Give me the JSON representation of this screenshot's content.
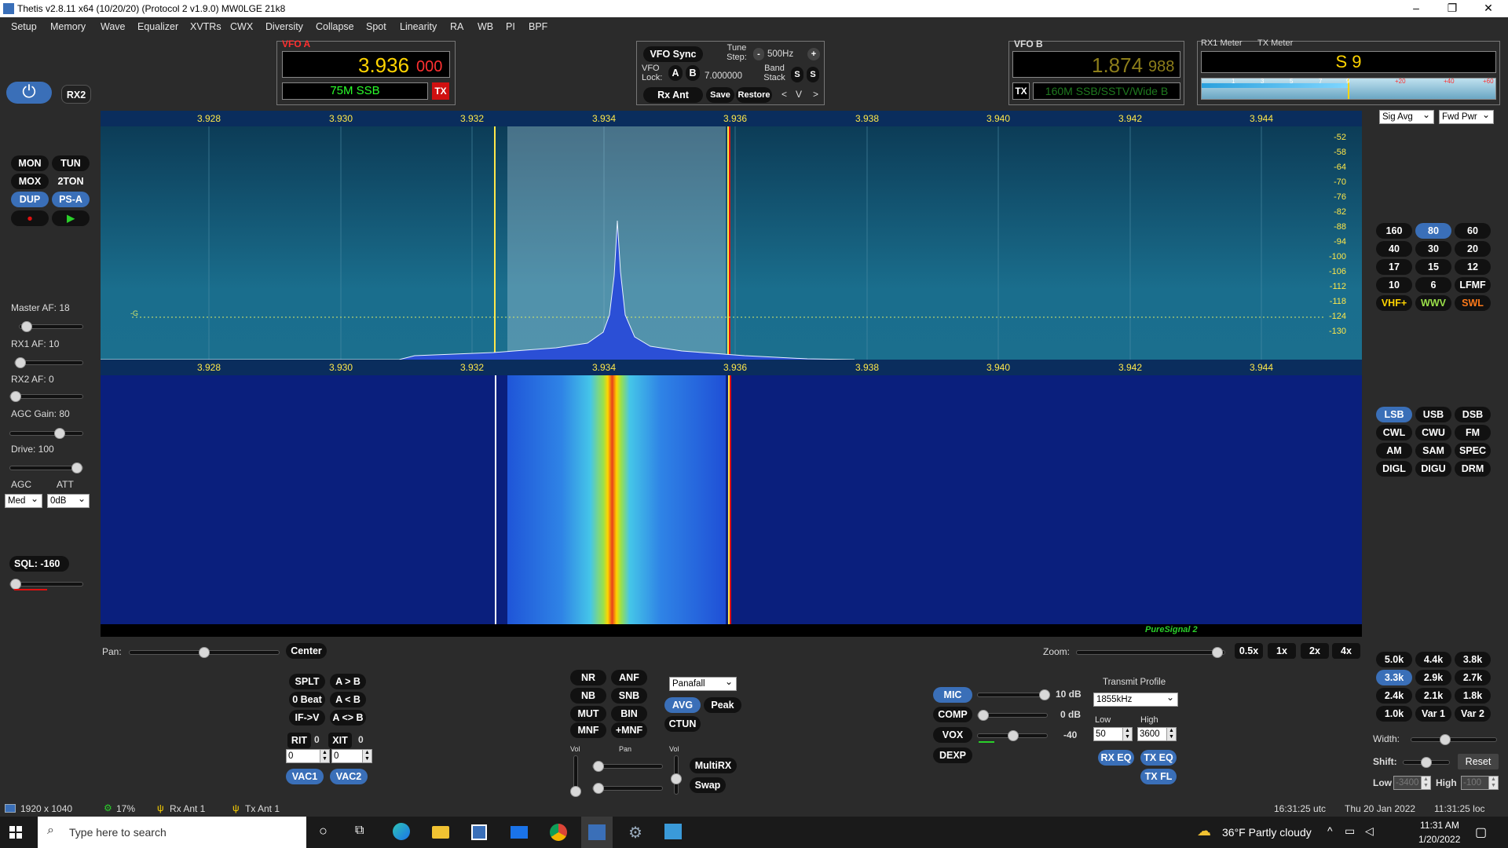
{
  "window": {
    "title": "Thetis v2.8.11 x64 (10/20/20) (Protocol 2 v1.9.0) MW0LGE 21k8",
    "min": "–",
    "max": "❐",
    "close": "✕"
  },
  "menu": [
    "Setup",
    "Memory",
    "Wave",
    "Equalizer",
    "XVTRs",
    "CWX",
    "Diversity",
    "Collapse",
    "Spot",
    "Linearity",
    "RA",
    "WB",
    "PI",
    "BPF"
  ],
  "vfoa": {
    "title": "VFO A",
    "freq_main": "3.936",
    "freq_sub": "000",
    "band": "75M SSB",
    "tx": "TX"
  },
  "vfosync": {
    "sync": "VFO Sync",
    "tune_step_label": "Tune Step:",
    "tune_step": "500Hz",
    "minus": "-",
    "plus": "+",
    "vfo_lock_label": "VFO Lock:",
    "a": "A",
    "b": "B",
    "lock_value": "7.000000",
    "band_stack_label": "Band Stack",
    "s1": "S",
    "s2": "S",
    "rx_ant": "Rx Ant",
    "save": "Save",
    "restore": "Restore",
    "nav_left": "<",
    "nav_v": "V",
    "nav_right": ">"
  },
  "vfob": {
    "title": "VFO B",
    "freq_main": "1.874",
    "freq_sub": "988",
    "tx": "TX",
    "band": "160M SSB/SSTV/Wide B"
  },
  "meter": {
    "rx_label": "RX1 Meter",
    "tx_label": "TX Meter",
    "reading": "S 9",
    "scale": [
      "1",
      "3",
      "5",
      "7",
      "9",
      "+20",
      "+40",
      "+60"
    ],
    "rx_mode": "Sig Avg",
    "tx_mode": "Fwd Pwr"
  },
  "left": {
    "power": "⏻",
    "rx2": "RX2",
    "mon": "MON",
    "tun": "TUN",
    "mox": "MOX",
    "ton": "2TON",
    "dup": "DUP",
    "psa": "PS-A",
    "record": "●",
    "play": "▶",
    "master_af": "Master AF:  18",
    "rx1_af": "RX1 AF:  10",
    "rx2_af": "RX2 AF:  0",
    "agc_gain": "AGC Gain:  80",
    "drive": "Drive:  100",
    "agc": "AGC",
    "att": "ATT",
    "agc_val": "Med",
    "att_val": "0dB",
    "sql": "SQL:  -160"
  },
  "freq_ticks": [
    "3.928",
    "3.930",
    "3.932",
    "3.934",
    "3.936",
    "3.938",
    "3.940",
    "3.942",
    "3.944"
  ],
  "db_ticks": [
    "-52",
    "-58",
    "-64",
    "-70",
    "-76",
    "-82",
    "-88",
    "-94",
    "-100",
    "-106",
    "-112",
    "-118",
    "-124",
    "-130"
  ],
  "marker": "-G",
  "bands": [
    "160",
    "80",
    "60",
    "40",
    "30",
    "20",
    "17",
    "15",
    "12",
    "10",
    "6",
    "LFMF",
    "VHF+",
    "WWV",
    "SWL"
  ],
  "modes": [
    "LSB",
    "USB",
    "DSB",
    "CWL",
    "CWU",
    "FM",
    "AM",
    "SAM",
    "SPEC",
    "DIGL",
    "DIGU",
    "DRM"
  ],
  "filters": [
    "5.0k",
    "4.4k",
    "3.8k",
    "3.3k",
    "2.9k",
    "2.7k",
    "2.4k",
    "2.1k",
    "1.8k",
    "1.0k",
    "Var 1",
    "Var 2"
  ],
  "filter_ctrl": {
    "width": "Width:",
    "shift": "Shift:",
    "reset": "Reset",
    "low": "Low",
    "low_val": "-3400",
    "high": "High",
    "high_val": "-100"
  },
  "puresignal": "PureSignal 2",
  "pan": {
    "label": "Pan:",
    "center": "Center",
    "zoom": "Zoom:",
    "z05": "0.5x",
    "z1": "1x",
    "z2": "2x",
    "z4": "4x"
  },
  "split": {
    "splt": "SPLT",
    "a_to_b": "A > B",
    "zero_beat": "0 Beat",
    "a_lt_b": "A < B",
    "if_v": "IF->V",
    "a_swap_b": "A <> B",
    "rit": "RIT",
    "rit_val": "0",
    "xit": "XIT",
    "xit_val": "0",
    "rit_input": "0",
    "xit_input": "0",
    "vac1": "VAC1",
    "vac2": "VAC2"
  },
  "dsp": {
    "nr": "NR",
    "anf": "ANF",
    "nb": "NB",
    "snb": "SNB",
    "mut": "MUT",
    "bin": "BIN",
    "mnf": "MNF",
    "pmnf": "+MNF",
    "display": "Panafall",
    "avg": "AVG",
    "peak": "Peak",
    "ctun": "CTUN",
    "vol": "Vol",
    "pan": "Pan",
    "vol2": "Vol",
    "multirx": "MultiRX",
    "swap": "Swap"
  },
  "tx": {
    "mic": "MIC",
    "mic_val": "10 dB",
    "comp": "COMP",
    "comp_val": "0 dB",
    "vox": "VOX",
    "vox_val": "-40",
    "dexp": "DEXP",
    "profile_label": "Transmit Profile",
    "profile": "1855kHz",
    "low": "Low",
    "high": "High",
    "low_val": "50",
    "high_val": "3600",
    "rxeq": "RX EQ",
    "txeq": "TX EQ",
    "txfl": "TX FL"
  },
  "status": {
    "res": "1920 x 1040",
    "cpu": "17%",
    "rxant": "Rx Ant 1",
    "txant": "Tx Ant 1",
    "utc": "16:31:25 utc",
    "date": "Thu 20 Jan 2022",
    "loc": "11:31:25 loc"
  },
  "taskbar": {
    "search": "Type here to search",
    "weather": "36°F  Partly cloudy",
    "time": "11:31 AM",
    "date": "1/20/2022"
  },
  "colors": {
    "accent": "#3a6fb8",
    "spectrum_fill": "#2b4fd6",
    "freq_text": "#ffe84a",
    "vfoa_freq": "#ffd400",
    "tx_red": "#e01010"
  }
}
